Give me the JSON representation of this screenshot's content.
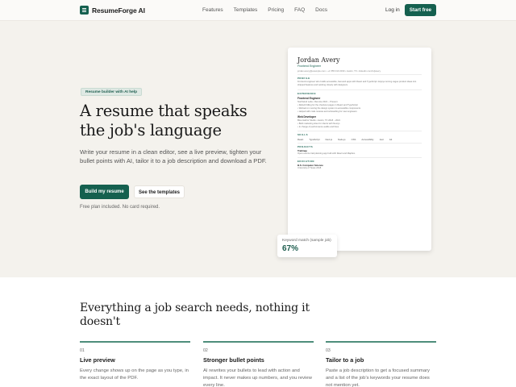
{
  "brand": {
    "name": "ResumeForge AI"
  },
  "nav": {
    "links": [
      "Features",
      "Templates",
      "Pricing",
      "FAQ",
      "Docs"
    ],
    "login": "Log in",
    "cta": "Start free"
  },
  "hero": {
    "badge": "Resume builder with AI help",
    "headline": "A resume that speaks the job's language",
    "subtitle": "Write your resume in a clean editor, see a live preview, tighten your bullet points with AI, tailor it to a job description and download a PDF.",
    "primary_button": "Build my resume",
    "secondary_button": "See the templates",
    "note": "Free plan included. No card required."
  },
  "resume": {
    "name": "Jordan Avery",
    "role": "Frontend Engineer",
    "contact": "jordan.avery@example.com  •  +1 555 010 2030  •  Austin, TX  •  linkedin.com/in/javery",
    "profile_heading": "PROFILE",
    "profile_text": "Frontend engineer who builds accessible, fast web apps with React and TypeScript. Enjoys turning vague product ideas into shipped features and working closely with designers.",
    "experience_heading": "EXPERIENCE",
    "job1_title": "Frontend Engineer",
    "job1_meta": "Northwind Labs  •  Remote        2021 – Present",
    "job1_b1": "• Rebuilt billing for the checkout pages in React and TypeScript",
    "job1_b2": "• Worked on moving the design system to accessible components",
    "job1_b3": "• Helped with code reviews and onboarding for new engineers",
    "job2_title": "Web Developer",
    "job2_meta": "Blue Harbor Studio  •  Austin, TX        2018 – 2021",
    "job2_b1": "• Built marketing sites for clients with Next.js",
    "job2_b2": "• In charge of performance audits and fixes",
    "skills_heading": "SKILLS",
    "skills": [
      "React",
      "TypeScript",
      "Next.js",
      "Node.js",
      "CSS",
      "Accessibility",
      "Jest",
      "Git"
    ],
    "projects_heading": "PROJECTS",
    "project_title": "Trailmap",
    "project_text": "Open-source trail planning app built with React and Mapbox.",
    "education_heading": "EDUCATION",
    "edu_title": "B.S. Computer Science",
    "edu_meta": "University of Texas        2018"
  },
  "keyword_match": {
    "label": "Keyword match (sample job)",
    "value": "67%"
  },
  "features": {
    "title": "Everything a job search needs, nothing it doesn't",
    "items": [
      {
        "num": "01",
        "title": "Live preview",
        "desc": "Every change shows up on the page as you type, in the exact layout of the PDF."
      },
      {
        "num": "02",
        "title": "Stronger bullet points",
        "desc": "AI rewrites your bullets to lead with action and impact. It never makes up numbers, and you review every line."
      },
      {
        "num": "03",
        "title": "Tailor to a job",
        "desc": "Paste a job description to get a focused summary and a list of the job's keywords your resume does not mention yet."
      }
    ]
  },
  "colors": {
    "accent": "#15604f",
    "hero_bg": "#f4f2ed"
  }
}
